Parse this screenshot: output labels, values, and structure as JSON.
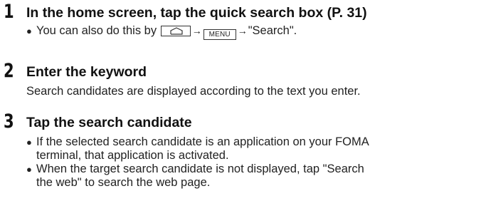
{
  "steps": [
    {
      "number": "1",
      "title": "In the home screen, tap the quick search box (P. 31)",
      "bullets": [
        {
          "prefix": "You can also do this by ",
          "key_home_icon": "home-key-icon",
          "arrow1": "→",
          "key_menu_label": "MENU",
          "arrow2": "→",
          "suffix": "\"Search\"."
        }
      ]
    },
    {
      "number": "2",
      "title": "Enter the keyword",
      "text": "Search candidates are displayed according to the text you enter."
    },
    {
      "number": "3",
      "title": "Tap the search candidate",
      "bullets": [
        {
          "line1": "If the selected search candidate is an application on your FOMA",
          "line2": "terminal, that application is activated."
        },
        {
          "line1": "When the target search candidate is not displayed, tap \"Search",
          "line2": "the web\" to search the web page."
        }
      ]
    }
  ],
  "bullet_symbol": "●"
}
